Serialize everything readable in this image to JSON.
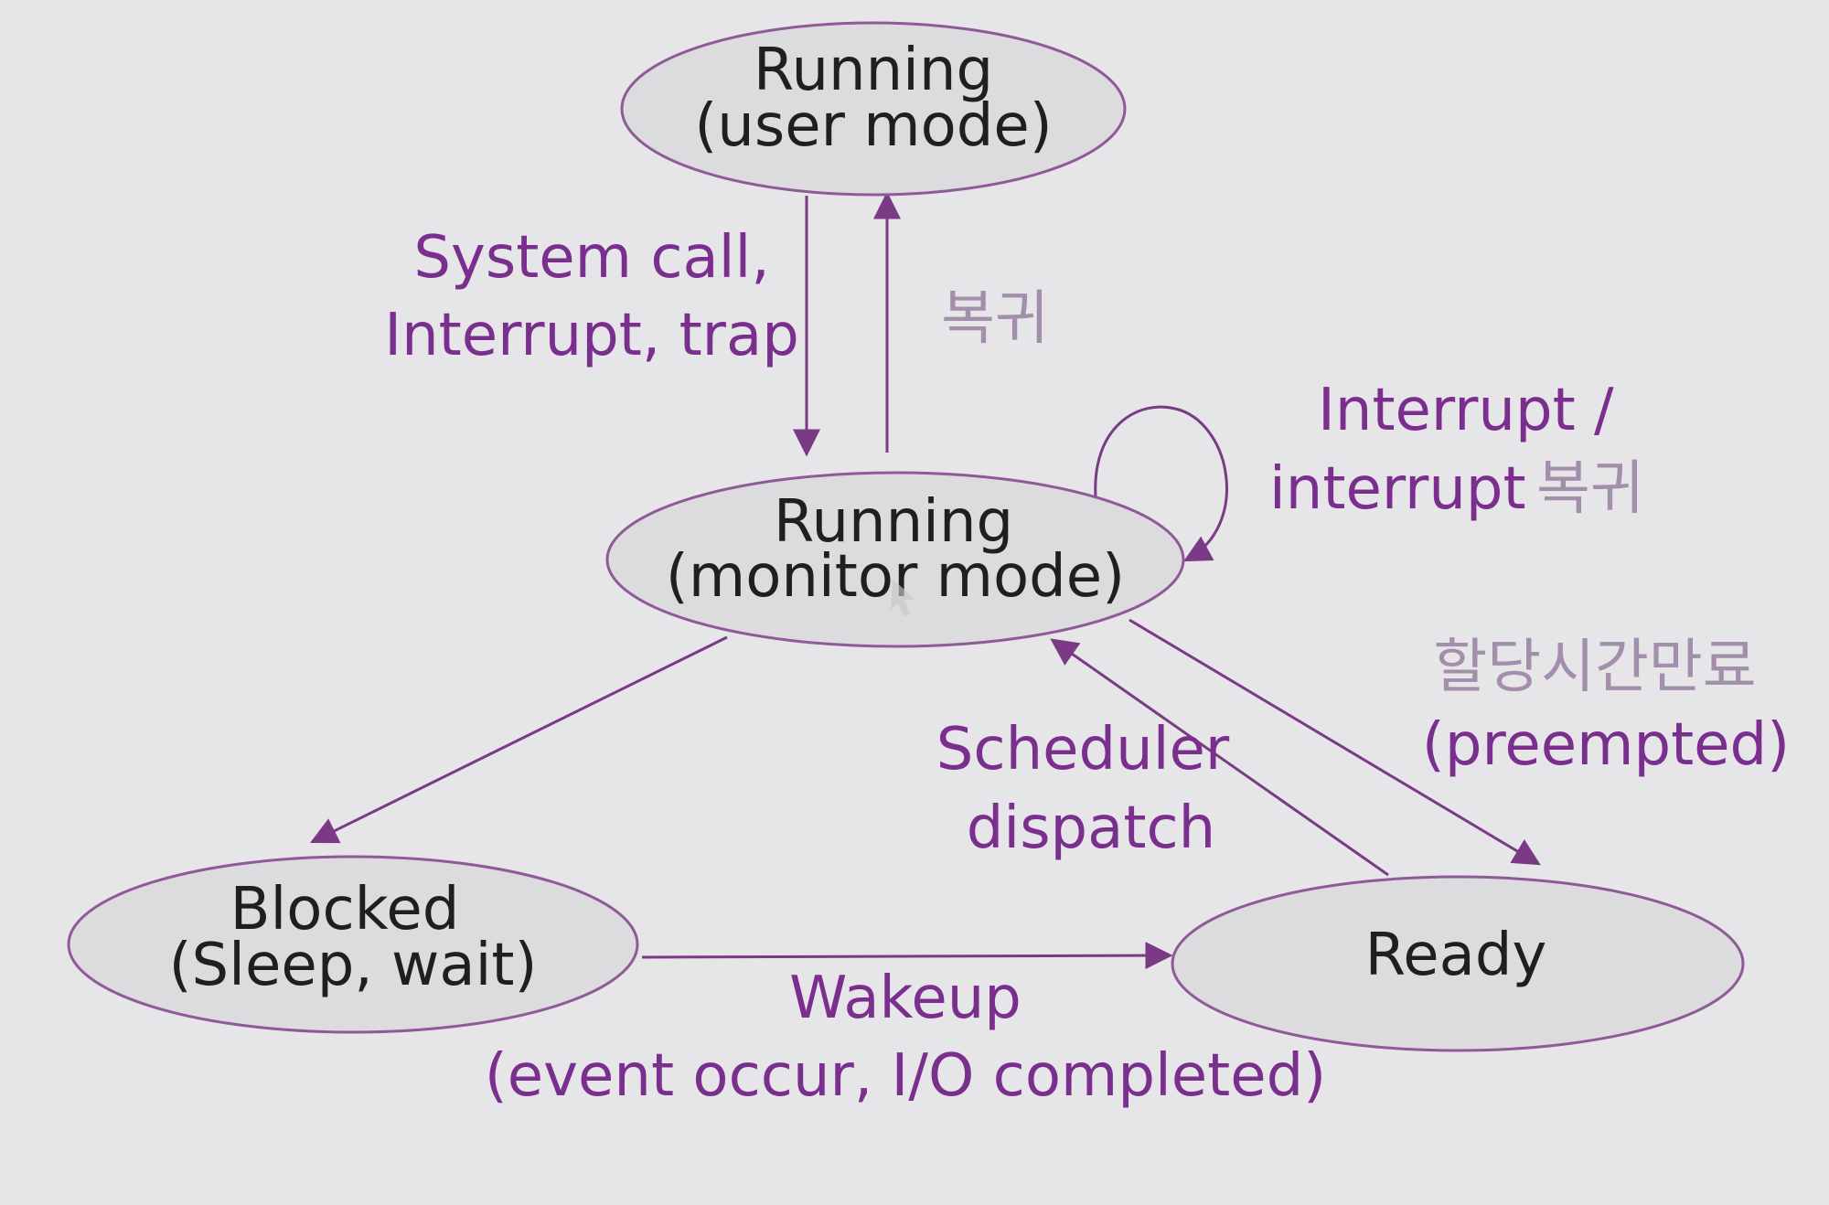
{
  "states": {
    "running_user": {
      "line1": "Running",
      "line2": "(user mode)"
    },
    "running_monitor": {
      "line1": "Running",
      "line2": "(monitor mode)"
    },
    "blocked": {
      "line1": "Blocked",
      "line2": "(Sleep, wait)"
    },
    "ready": {
      "line1": "Ready"
    }
  },
  "transitions": {
    "system_call": {
      "line1": "System call,",
      "line2": "Interrupt, trap"
    },
    "return_user": {
      "line1": "복귀"
    },
    "interrupt_loop": {
      "line1": "Interrupt /",
      "line2_en": "interrupt",
      "line2_ko": "복귀"
    },
    "preempted": {
      "line1": "할당시간만료",
      "line2": "(preempted)"
    },
    "scheduler_dispatch": {
      "line1": "Scheduler",
      "line2": "dispatch"
    },
    "wakeup": {
      "line1": "Wakeup",
      "line2": "(event occur, I/O completed)"
    }
  },
  "colors": {
    "background": "#e6e5e7",
    "state_fill": "#dcdbde",
    "state_stroke": "#8e5b98",
    "edge": "#7a3a86",
    "label": "#7a2f8e",
    "korean_label": "#a38eab"
  }
}
